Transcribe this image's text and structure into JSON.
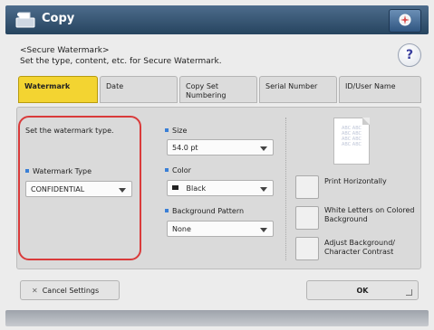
{
  "header": {
    "title": "Copy",
    "app_icon": "copy-machine-icon",
    "settings_icon": "settings-icon",
    "accent_color": "#26445f"
  },
  "instructions": {
    "line1": "<Secure Watermark>",
    "line2": "Set the type, content, etc. for Secure Watermark.",
    "help_label": "?"
  },
  "tabs": [
    {
      "label": "Watermark",
      "active": true
    },
    {
      "label": "Date",
      "active": false
    },
    {
      "label": "Copy Set Numbering",
      "active": false
    },
    {
      "label": "Serial Number",
      "active": false
    },
    {
      "label": "ID/User Name",
      "active": false
    }
  ],
  "left_section": {
    "prompt": "Set the watermark type.",
    "type_label": "Watermark Type",
    "type_value": "CONFIDENTIAL",
    "highlight_color": "#d93a3a"
  },
  "middle_section": {
    "size_label": "Size",
    "size_value": "54.0 pt",
    "color_label": "Color",
    "color_value": "Black",
    "pattern_label": "Background Pattern",
    "pattern_value": "None"
  },
  "right_section": {
    "preview_text": "ABC ABC",
    "options": [
      {
        "label": "Print Horizontally"
      },
      {
        "label": "White Letters on Colored Background"
      },
      {
        "label": "Adjust Background/ Character Contrast"
      }
    ]
  },
  "footer": {
    "cancel_label": "Cancel Settings",
    "ok_label": "OK"
  }
}
